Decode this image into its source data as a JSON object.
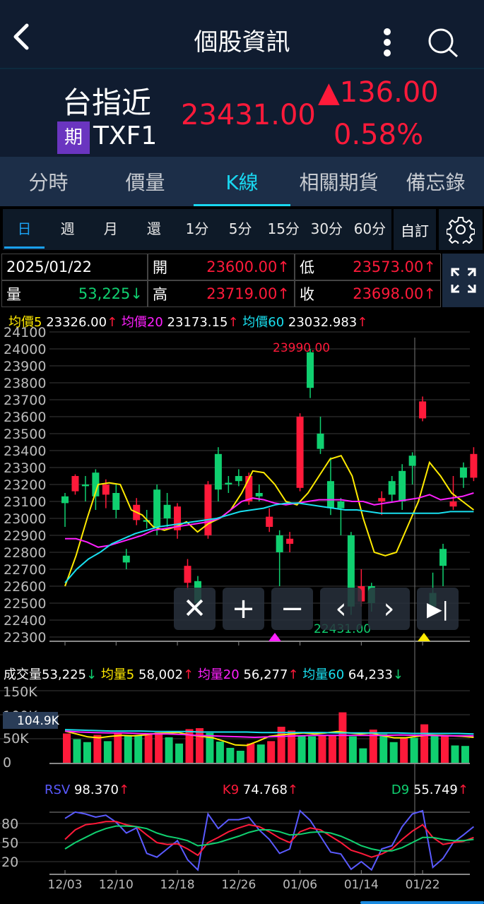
{
  "header": {
    "title": "個股資訊",
    "back": "back",
    "more": "more",
    "search": "search"
  },
  "quote": {
    "name": "台指近",
    "badge": "期",
    "code": "TXF1",
    "price": "23431.00",
    "change": "▲136.00",
    "change_pct": "0.58%"
  },
  "tabs": [
    "分時",
    "價量",
    "K線",
    "相關期貨",
    "備忘錄"
  ],
  "active_tab": 2,
  "periods": [
    "日",
    "週",
    "月",
    "還",
    "1分",
    "5分",
    "15分",
    "30分",
    "60分"
  ],
  "custom_label": "自訂",
  "ohlc": {
    "date": "2025/01/22",
    "open_label": "開",
    "open": "23600.00↑",
    "low_label": "低",
    "low": "23573.00↑",
    "vol_label": "量",
    "vol": "53,225↓",
    "high_label": "高",
    "high": "23719.00↑",
    "close_label": "收",
    "close": "23698.00↑"
  },
  "ma": {
    "ma5_label": "均價5",
    "ma5": "23326.00",
    "ma20_label": "均價20",
    "ma20": "23173.15",
    "ma60_label": "均價60",
    "ma60": "23032.983",
    "arrow_up": "↑",
    "arrow_down": "↓"
  },
  "chart_data": [
    {
      "type": "candlestick",
      "title": "K線",
      "y_ticks": [
        24100,
        24000,
        23900,
        23800,
        23700,
        23600,
        23500,
        23400,
        23300,
        23200,
        23100,
        23000,
        22900,
        22800,
        22700,
        22600,
        22500,
        22400,
        22300
      ],
      "ylim": [
        22300,
        24100
      ],
      "x_labels": [
        "12/03",
        "12/10",
        "12/18",
        "12/26",
        "01/06",
        "01/14",
        "01/22"
      ],
      "x_label_index": [
        0,
        5,
        11,
        17,
        23,
        29,
        35
      ],
      "candles": [
        [
          23130,
          23090,
          23150,
          22950
        ],
        [
          23160,
          23250,
          23260,
          23140
        ],
        [
          23200,
          23190,
          23250,
          23100
        ],
        [
          23270,
          23130,
          23290,
          23050
        ],
        [
          23140,
          23200,
          23230,
          23060
        ],
        [
          23150,
          23050,
          23200,
          23000
        ],
        [
          22780,
          22740,
          22820,
          22700
        ],
        [
          22990,
          23080,
          23120,
          22960
        ],
        [
          22990,
          22980,
          23050,
          22940
        ],
        [
          23170,
          22950,
          23200,
          22900
        ],
        [
          23080,
          23000,
          23150,
          22950
        ],
        [
          22930,
          23070,
          23090,
          22880
        ],
        [
          22620,
          22720,
          22760,
          22580
        ],
        [
          22630,
          22500,
          22660,
          22450
        ],
        [
          22900,
          23200,
          23220,
          22880
        ],
        [
          23380,
          23170,
          23420,
          23100
        ],
        [
          23210,
          23200,
          23250,
          23150
        ],
        [
          23250,
          23220,
          23290,
          23190
        ],
        [
          23100,
          23250,
          23270,
          23080
        ],
        [
          23150,
          23130,
          23200,
          23100
        ],
        [
          22950,
          23010,
          23060,
          22920
        ],
        [
          22900,
          22800,
          22930,
          22600
        ],
        [
          22850,
          22880,
          22920,
          22800
        ],
        [
          23180,
          23600,
          23620,
          23160
        ],
        [
          23980,
          23770,
          24000,
          23710
        ],
        [
          23500,
          23410,
          23600,
          23380
        ],
        [
          23220,
          23060,
          23360,
          23020
        ],
        [
          23100,
          23060,
          23120,
          22900
        ],
        [
          22900,
          22480,
          22920,
          22431
        ],
        [
          22510,
          22600,
          22700,
          22480
        ],
        [
          22600,
          22500,
          22620,
          22450
        ],
        [
          23100,
          23120,
          23160,
          23020
        ],
        [
          23220,
          23140,
          23250,
          23100
        ],
        [
          23280,
          23100,
          23320,
          23050
        ],
        [
          23370,
          23310,
          23390,
          23200
        ],
        [
          23590,
          23690,
          23719,
          23573
        ],
        [
          22560,
          22480,
          22680,
          22430
        ],
        [
          22820,
          22720,
          22850,
          22600
        ],
        [
          23070,
          23100,
          23250,
          23050
        ],
        [
          23300,
          23240,
          23330,
          23180
        ],
        [
          23240,
          23380,
          23420,
          23220
        ]
      ],
      "annotations": {
        "high": "23990.00",
        "low": "22431.00"
      },
      "series": [
        {
          "name": "均價5",
          "color": "#ffea00",
          "values": [
            22600,
            22780,
            23000,
            23200,
            23210,
            23200,
            23050,
            23020,
            22950,
            22930,
            22950,
            22980,
            22920,
            22970,
            23000,
            23050,
            23150,
            23280,
            23270,
            23200,
            23100,
            23080,
            23150,
            23250,
            23350,
            23370,
            23250,
            23000,
            22800,
            22780,
            22800,
            22950,
            23100,
            23330,
            23250,
            23150,
            23100,
            23050
          ]
        },
        {
          "name": "均價20",
          "color": "#ff20ff",
          "values": [
            22880,
            22880,
            22860,
            22830,
            22840,
            22860,
            22880,
            22900,
            22930,
            22940,
            22950,
            22960,
            22970,
            22980,
            23000,
            23050,
            23100,
            23120,
            23110,
            23090,
            23080,
            23090,
            23100,
            23110,
            23110,
            23110,
            23100,
            23100,
            23080,
            23090,
            23100,
            23110,
            23120,
            23140,
            23110,
            23120,
            23130,
            23150
          ]
        },
        {
          "name": "均價60",
          "color": "#19e0f0",
          "values": [
            22620,
            22700,
            22760,
            22800,
            22850,
            22880,
            22910,
            22930,
            22950,
            22960,
            22970,
            22980,
            22990,
            23000,
            23020,
            23040,
            23050,
            23060,
            23080,
            23090,
            23090,
            23080,
            23070,
            23060,
            23050,
            23050,
            23040,
            23030,
            23030,
            23030,
            23030,
            23030,
            23030,
            23040,
            23040,
            23040
          ]
        }
      ]
    },
    {
      "type": "bar",
      "title": "成交量",
      "y_ticks": [
        "150K",
        "100K",
        "50K",
        "0"
      ],
      "ylim": [
        0,
        150
      ],
      "marker": "104.9K",
      "values": [
        61,
        49,
        43,
        58,
        45,
        61,
        57,
        57,
        62,
        63,
        53,
        40,
        70,
        72,
        62,
        44,
        31,
        25,
        40,
        38,
        45,
        75,
        67,
        57,
        55,
        58,
        57,
        105,
        55,
        30,
        69,
        60,
        43,
        52,
        52,
        80,
        56,
        57,
        36,
        35
      ],
      "up": [
        1,
        0,
        0,
        1,
        0,
        1,
        0,
        0,
        1,
        1,
        0,
        0,
        1,
        1,
        0,
        0,
        0,
        0,
        1,
        0,
        1,
        1,
        1,
        0,
        0,
        1,
        1,
        1,
        0,
        0,
        1,
        0,
        0,
        1,
        0,
        1,
        0,
        1,
        0,
        0
      ],
      "legend": {
        "vol_label": "成交量",
        "vol": "53,225",
        "v5_label": "均量5",
        "v5": "58,002",
        "v20_label": "均量20",
        "v20": "56,277",
        "v60_label": "均量60",
        "v60": "64,233"
      },
      "series": [
        {
          "name": "均量5",
          "color": "#ffea00",
          "values": [
            66,
            60,
            54,
            52,
            55,
            57,
            56,
            58,
            61,
            62,
            63,
            58,
            55,
            52,
            45,
            37,
            36,
            45,
            55,
            58,
            60,
            62,
            60,
            62,
            65,
            62,
            60,
            62,
            56,
            52,
            52,
            55,
            58,
            57,
            56,
            55,
            53
          ]
        },
        {
          "name": "均量20",
          "color": "#ff20ff",
          "values": [
            66,
            64,
            63,
            62,
            62,
            61,
            60,
            60,
            59,
            57,
            56,
            55,
            54,
            53,
            54,
            55,
            56,
            57,
            57,
            57,
            57,
            57,
            57,
            58,
            57,
            57,
            56,
            56,
            56
          ]
        },
        {
          "name": "均量60",
          "color": "#19e0f0",
          "values": [
            69,
            68,
            67,
            66,
            66,
            66,
            65,
            65,
            65,
            64,
            64,
            64,
            64,
            63,
            63,
            63,
            63,
            63,
            62,
            62,
            62,
            62,
            62,
            61,
            61,
            61,
            61,
            60
          ]
        }
      ]
    },
    {
      "type": "line",
      "title": "KD",
      "y_ticks": [
        80,
        50,
        20
      ],
      "ylim": [
        0,
        100
      ],
      "legend": {
        "rsv_label": "RSV",
        "rsv": "98.370",
        "k_label": "K9",
        "k": "74.768",
        "d_label": "D9",
        "d": "55.749"
      },
      "series": [
        {
          "name": "RSV",
          "color": "#5a5aff",
          "values": [
            88,
            98,
            95,
            90,
            93,
            82,
            65,
            73,
            33,
            27,
            40,
            53,
            23,
            7,
            95,
            72,
            86,
            86,
            90,
            70,
            55,
            33,
            40,
            100,
            85,
            60,
            35,
            32,
            8,
            20,
            7,
            40,
            45,
            75,
            95,
            100,
            11,
            25,
            50,
            62,
            75
          ]
        },
        {
          "name": "K9",
          "color": "#ff1a3a",
          "values": [
            55,
            70,
            78,
            80,
            83,
            83,
            78,
            75,
            62,
            50,
            47,
            48,
            40,
            30,
            50,
            58,
            67,
            73,
            78,
            75,
            67,
            57,
            50,
            67,
            73,
            70,
            60,
            50,
            38,
            33,
            27,
            32,
            40,
            55,
            68,
            78,
            58,
            47,
            50,
            52,
            58
          ]
        },
        {
          "name": "D9",
          "color": "#10d070",
          "values": [
            40,
            50,
            58,
            66,
            72,
            76,
            76,
            75,
            72,
            65,
            60,
            57,
            53,
            45,
            47,
            50,
            55,
            60,
            66,
            70,
            70,
            67,
            62,
            63,
            66,
            67,
            65,
            60,
            53,
            45,
            40,
            37,
            37,
            42,
            50,
            58,
            58,
            55,
            53,
            53,
            55
          ]
        }
      ]
    }
  ],
  "controls": [
    "✕",
    "+",
    "−",
    "‹",
    "›",
    "▶|"
  ]
}
